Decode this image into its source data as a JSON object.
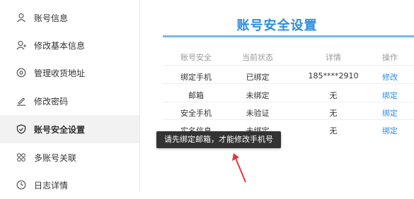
{
  "sidebar": {
    "items": [
      {
        "label": "账号信息",
        "icon": "user-icon"
      },
      {
        "label": "修改基本信息",
        "icon": "user-edit-icon"
      },
      {
        "label": "管理收货地址",
        "icon": "location-pin-icon"
      },
      {
        "label": "修改密码",
        "icon": "pen-icon"
      },
      {
        "label": "账号安全设置",
        "icon": "shield-icon",
        "active": true
      },
      {
        "label": "多账号关联",
        "icon": "accounts-link-icon"
      },
      {
        "label": "日志详情",
        "icon": "clock-icon"
      }
    ]
  },
  "main": {
    "title": "账号安全设置",
    "table": {
      "headers": [
        "账号安全",
        "当前状态",
        "详情",
        "操作"
      ],
      "rows": [
        {
          "item": "绑定手机",
          "status": "已绑定",
          "detail": "185****2910",
          "action": "修改"
        },
        {
          "item": "邮箱",
          "status": "未绑定",
          "detail": "无",
          "action": "绑定"
        },
        {
          "item": "安全手机",
          "status": "未验证",
          "detail": "无",
          "action": "绑定"
        },
        {
          "item": "实名信息",
          "status": "未绑定",
          "detail": "无",
          "action": "绑定"
        }
      ]
    },
    "tooltip": "请先绑定邮箱，才能修改手机号"
  },
  "colors": {
    "accent": "#2b8de0",
    "annotation": "#e53935",
    "tooltip_bg": "#333333"
  }
}
